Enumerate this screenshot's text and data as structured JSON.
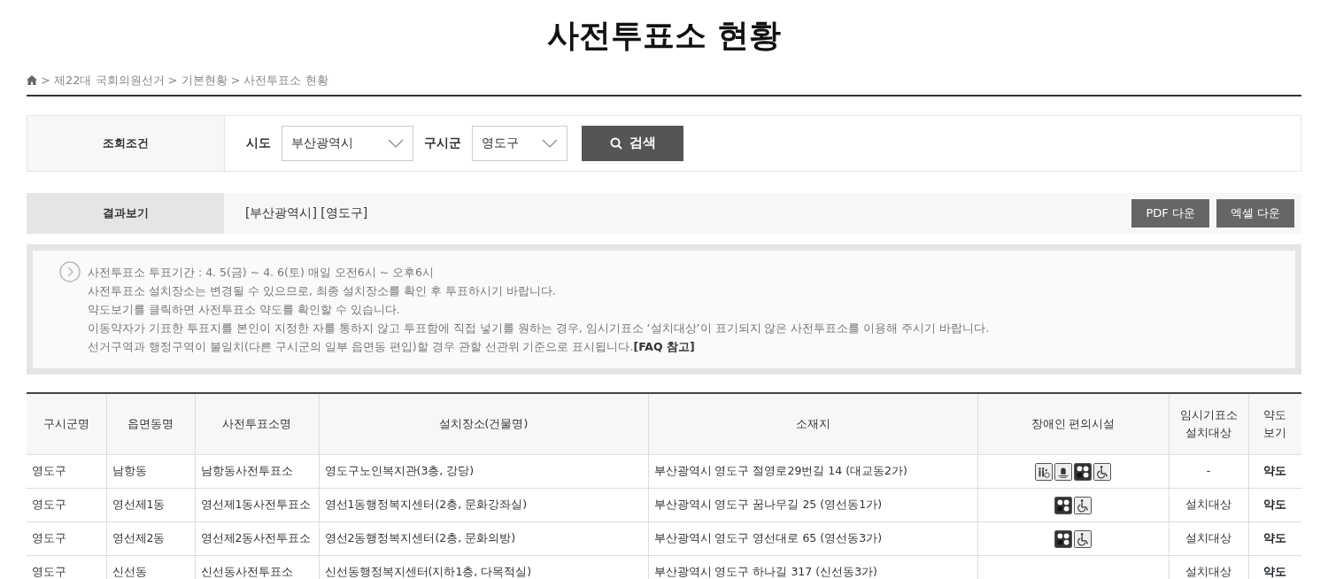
{
  "title": "사전투표소 현황",
  "breadcrumb": [
    {
      "separator": ">",
      "label": "제22대 국회의원선거"
    },
    {
      "separator": ">",
      "label": "기본현황"
    },
    {
      "separator": ">",
      "label": "사전투표소 현황"
    }
  ],
  "search": {
    "label": "조회조건",
    "fields": [
      {
        "label": "시도",
        "value": "부산광역시"
      },
      {
        "label": "구시군",
        "value": "영도구"
      }
    ],
    "button": "검색"
  },
  "result": {
    "label": "결과보기",
    "summary": "[부산광역시] [영도구]",
    "buttons": [
      "PDF 다운",
      "엑셀 다운"
    ]
  },
  "notices": [
    "사전투표소 투표기간 : 4. 5(금) ~ 4. 6(토) 매일 오전6시 ~ 오후6시",
    "사전투표소 설치장소는 변경될 수 있으므로, 최종 설치장소를 확인 후 투표하시기 바랍니다.",
    "약도보기를 클릭하면 사전투표소 약도를 확인할 수 있습니다.",
    "이동약자가 기표한 투표지를 본인이 지정한 자를 통하지 않고 투표함에 직접 넣기를 원하는 경우, 임시기표소 ‘설치대상’이 표기되지 않은 사전투표소를 이용해 주시기 바랍니다.",
    "선거구역과 행정구역이 불일치(다른 구시군의 일부 읍면동 편입)할 경우 관할 선관위 기준으로 표시됩니다.**[FAQ 참고]**"
  ],
  "table": {
    "columns": [
      "구시군명",
      "읍면동명",
      "사전투표소명",
      "설치장소(건물명)",
      "소재지",
      "장애인 편의시설",
      "임시기표소\n설치대상",
      "약도\n보기"
    ],
    "rows": [
      {
        "district": "영도구",
        "dong": "남항동",
        "station": "남항동사전투표소",
        "place": "영도구노인복지관(3층, 강당)",
        "address": "부산광역시 영도구 절영로29번길 14 (대교동2가)",
        "facilities": [
          {
            "kind": "toilet"
          },
          {
            "kind": "bell"
          },
          {
            "kind": "dots"
          },
          {
            "kind": "wheelchair"
          }
        ],
        "booth": "-",
        "map": "약도"
      },
      {
        "district": "영도구",
        "dong": "영선제1동",
        "station": "영선제1동사전투표소",
        "place": "영선1동행정복지센터(2층, 문화강좌실)",
        "address": "부산광역시 영도구 꿈나무길 25 (영선동1가)",
        "facilities": [
          {
            "kind": "dots"
          },
          {
            "kind": "wheelchair"
          }
        ],
        "booth": "설치대상",
        "map": "약도"
      },
      {
        "district": "영도구",
        "dong": "영선제2동",
        "station": "영선제2동사전투표소",
        "place": "영선2동행정복지센터(2층, 문화의방)",
        "address": "부산광역시 영도구 영선대로 65 (영선동3가)",
        "facilities": [
          {
            "kind": "dots"
          },
          {
            "kind": "wheelchair"
          }
        ],
        "booth": "설치대상",
        "map": "약도"
      },
      {
        "district": "영도구",
        "dong": "신선동",
        "station": "신선동사전투표소",
        "place": "신선동행정복지센터(지하1층, 다목적실)",
        "address": "부산광역시 영도구 하나길 317 (신선동3가)",
        "booth": "설치대상",
        "map": "약도"
      }
    ]
  }
}
